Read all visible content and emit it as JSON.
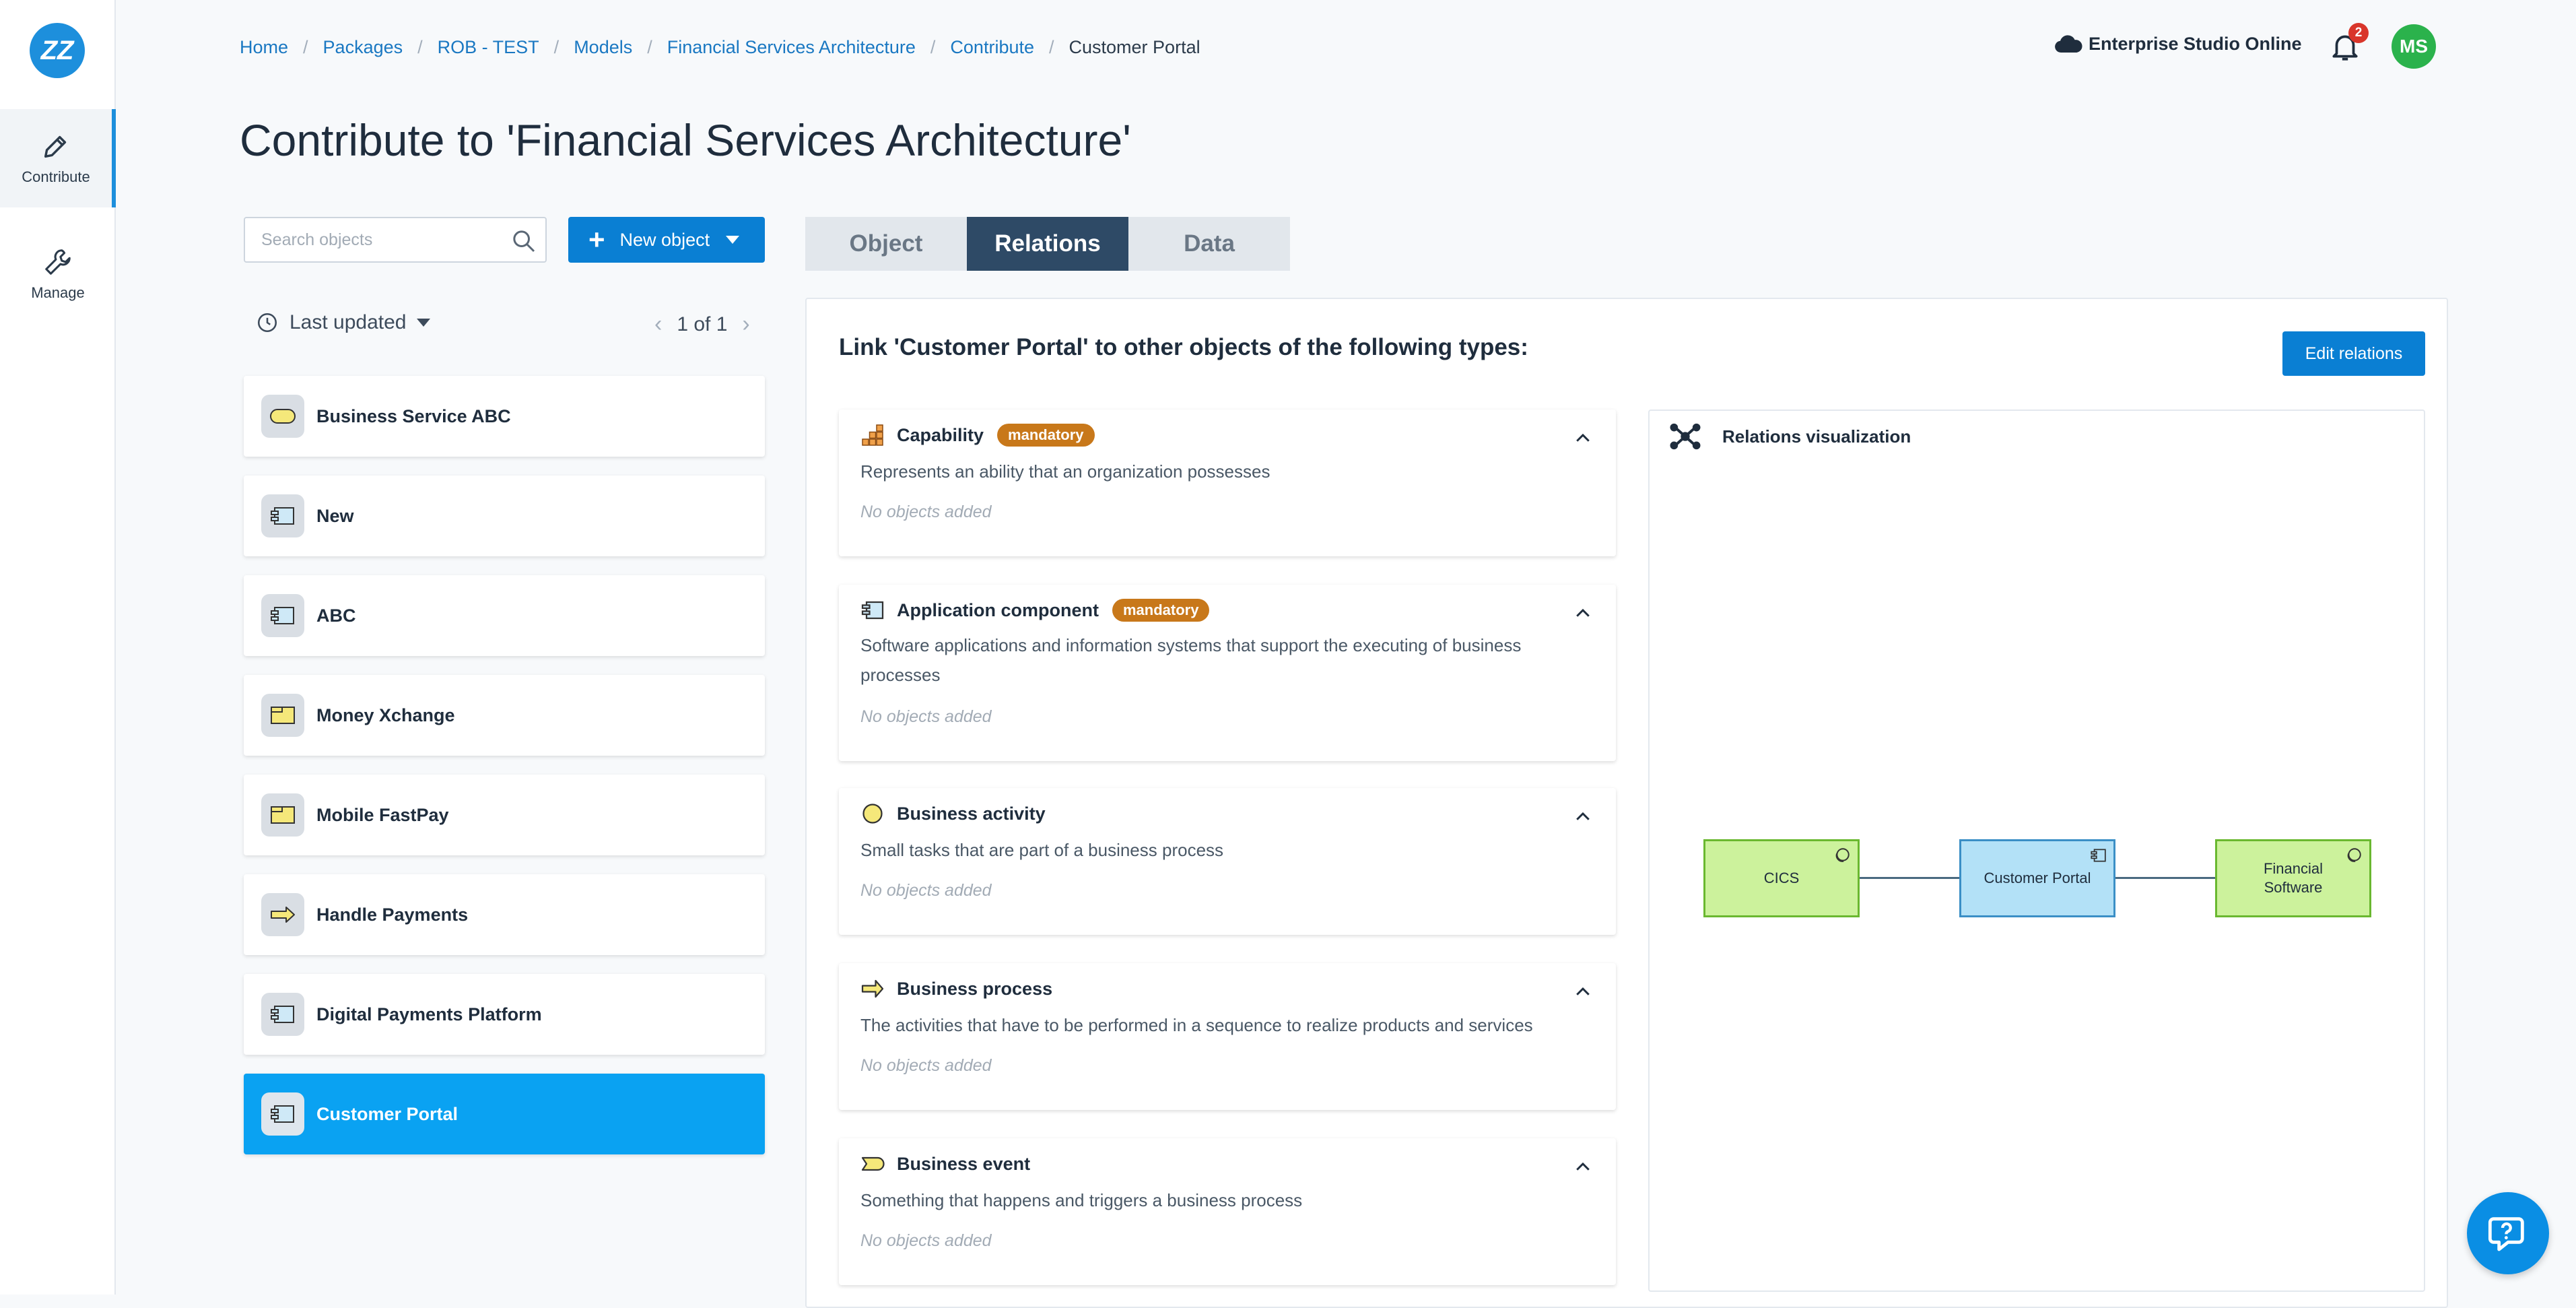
{
  "app": {
    "logo": "ZZ",
    "environment": "Enterprise Studio Online",
    "notifications": "2",
    "user_initials": "MS"
  },
  "rail": {
    "contribute": "Contribute",
    "manage": "Manage"
  },
  "breadcrumb": [
    "Home",
    "Packages",
    "ROB - TEST",
    "Models",
    "Financial Services Architecture",
    "Contribute",
    "Customer Portal"
  ],
  "page_title": "Contribute to 'Financial Services Architecture'",
  "search": {
    "placeholder": "Search objects"
  },
  "new_object_label": "New object",
  "sort_label": "Last updated",
  "pager": "1 of 1",
  "objects": [
    "Business Service ABC",
    "New",
    "ABC",
    "Money Xchange",
    "Mobile FastPay",
    "Handle Payments",
    "Digital Payments Platform",
    "Customer Portal"
  ],
  "tabs": [
    "Object",
    "Relations",
    "Data"
  ],
  "relations": {
    "heading": "Link 'Customer Portal' to other objects of the following types:",
    "edit_label": "Edit relations",
    "types": [
      {
        "name": "Capability",
        "badge": "mandatory",
        "desc": "Represents an ability that an organization possesses",
        "empty": "No objects added",
        "icon": "capability-icon"
      },
      {
        "name": "Application component",
        "badge": "mandatory",
        "desc": "Software applications and information systems that support the executing of business processes",
        "empty": "No objects added",
        "icon": "application-component-icon"
      },
      {
        "name": "Business activity",
        "desc": "Small tasks that are part of a business process",
        "empty": "No objects added",
        "icon": "business-activity-icon"
      },
      {
        "name": "Business process",
        "desc": "The activities that have to be performed in a sequence to realize products and services",
        "empty": "No objects added",
        "icon": "business-process-icon"
      },
      {
        "name": "Business event",
        "desc": "Something that happens and triggers a business process",
        "empty": "No objects added",
        "icon": "business-event-icon"
      }
    ]
  },
  "viz": {
    "title": "Relations visualization",
    "nodes": [
      "CICS",
      "Customer Portal",
      "Financial Software"
    ]
  },
  "colors": {
    "accent": "#0a7fd3",
    "selected": "#0aa2f2",
    "tab_active": "#2e4a66",
    "mandatory": "#c8781a"
  }
}
